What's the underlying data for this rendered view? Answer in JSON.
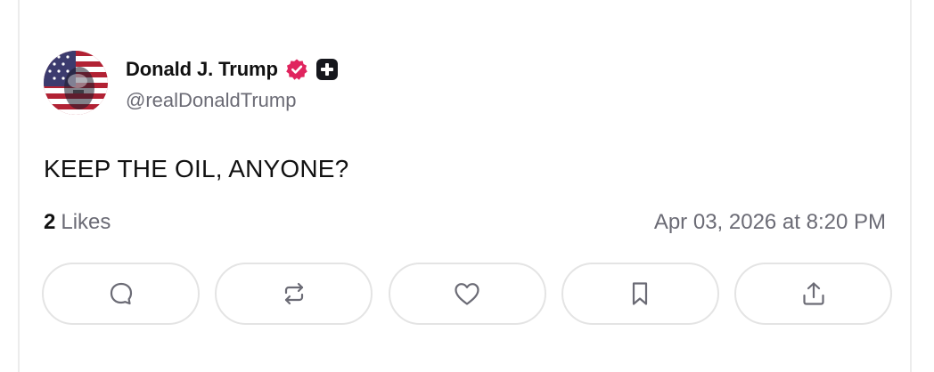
{
  "post": {
    "author": {
      "display_name": "Donald J. Trump",
      "handle": "@realDonaldTrump",
      "verified": true,
      "verified_color": "#e0245e"
    },
    "text": "KEEP THE OIL, ANYONE?",
    "likes_count": "2",
    "likes_label": "Likes",
    "timestamp": "Apr 03, 2026 at 8:20 PM"
  },
  "actions": [
    {
      "name": "reply",
      "icon": "comment-icon"
    },
    {
      "name": "repost",
      "icon": "repost-icon"
    },
    {
      "name": "like",
      "icon": "heart-icon"
    },
    {
      "name": "bookmark",
      "icon": "bookmark-icon"
    },
    {
      "name": "share",
      "icon": "share-icon"
    }
  ],
  "colors": {
    "text_primary": "#111111",
    "text_secondary": "#6b6b75",
    "border": "#e4e4e4",
    "icon": "#6b6b75"
  }
}
